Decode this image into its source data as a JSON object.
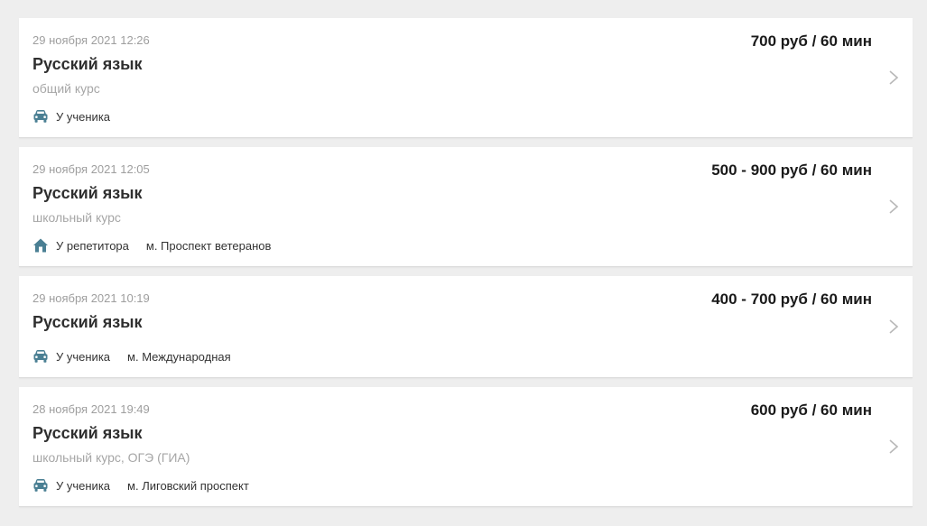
{
  "colors": {
    "background": "#eeeeee",
    "card": "#ffffff",
    "icon": "#4a7f93",
    "muted": "#9e9e9e",
    "chevron": "#b8b8b8"
  },
  "listings": [
    {
      "date": "29 ноября 2021 12:26",
      "price": "700 руб / 60 мин",
      "subject": "Русский язык",
      "course": "общий курс",
      "location_icon": "car-icon",
      "location": "У ученика",
      "metro": ""
    },
    {
      "date": "29 ноября 2021 12:05",
      "price": "500 - 900 руб / 60 мин",
      "subject": "Русский язык",
      "course": "школьный курс",
      "location_icon": "home-icon",
      "location": "У репетитора",
      "metro": "м. Проспект ветеранов"
    },
    {
      "date": "29 ноября 2021 10:19",
      "price": "400 - 700 руб / 60 мин",
      "subject": "Русский язык",
      "course": "",
      "location_icon": "car-icon",
      "location": "У ученика",
      "metro": "м. Международная"
    },
    {
      "date": "28 ноября 2021 19:49",
      "price": "600 руб / 60 мин",
      "subject": "Русский язык",
      "course": "школьный курс, ОГЭ (ГИА)",
      "location_icon": "car-icon",
      "location": "У ученика",
      "metro": "м. Лиговский проспект"
    }
  ]
}
